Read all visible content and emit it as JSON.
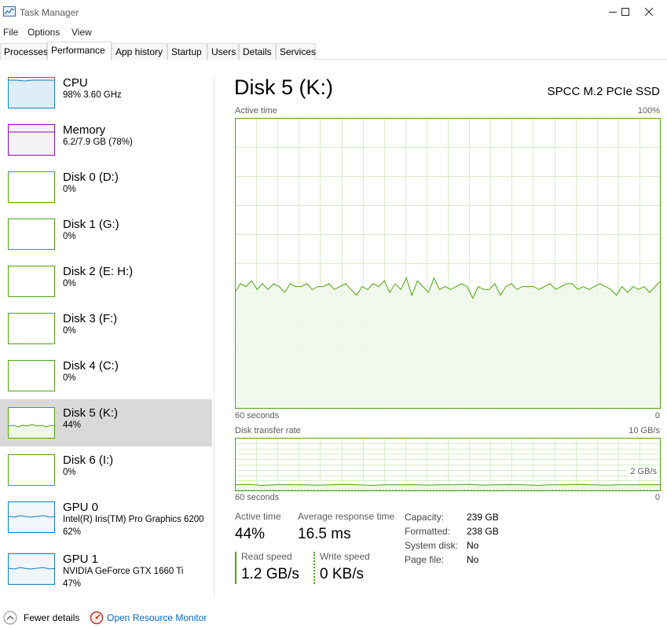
{
  "window": {
    "title": "Task Manager"
  },
  "menu": [
    "File",
    "Options",
    "View"
  ],
  "tabs": [
    "Processes",
    "Performance",
    "App history",
    "Startup",
    "Users",
    "Details",
    "Services"
  ],
  "active_tab": "Performance",
  "sidebar": {
    "items": [
      {
        "name": "CPU",
        "sub": "98% 3.60 GHz",
        "color": "#117dbb",
        "fill": "#f1f6fa"
      },
      {
        "name": "Memory",
        "sub": "6.2/7.9 GB (78%)",
        "color": "#8b12ae",
        "fill": "#f4f2f4"
      },
      {
        "name": "Disk 0 (D:)",
        "sub": "0%",
        "color": "#4da60c",
        "fill": "#ffffff"
      },
      {
        "name": "Disk 1 (G:)",
        "sub": "0%",
        "color": "#4da60c",
        "fill": "#ffffff"
      },
      {
        "name": "Disk 2 (E: H:)",
        "sub": "0%",
        "color": "#4da60c",
        "fill": "#ffffff"
      },
      {
        "name": "Disk 3 (F:)",
        "sub": "0%",
        "color": "#4da60c",
        "fill": "#ffffff"
      },
      {
        "name": "Disk 4 (C:)",
        "sub": "0%",
        "color": "#4da60c",
        "fill": "#ffffff"
      },
      {
        "name": "Disk 5 (K:)",
        "sub": "44%",
        "color": "#4da60c",
        "fill": "#ffffff"
      },
      {
        "name": "Disk 6 (I:)",
        "sub": "0%",
        "color": "#4da60c",
        "fill": "#ffffff"
      },
      {
        "name": "GPU 0",
        "sub": "Intel(R) Iris(TM) Pro Graphics 6200",
        "sub2": "62%",
        "color": "#117dbb",
        "fill": "#f1f6fa"
      },
      {
        "name": "GPU 1",
        "sub": "NVIDIA GeForce GTX 1660 Ti",
        "sub2": "47%",
        "color": "#117dbb",
        "fill": "#f1f6fa"
      }
    ],
    "selected_index": 7
  },
  "main": {
    "title": "Disk 5 (K:)",
    "model": "SPCC M.2 PCIe SSD",
    "graph1": {
      "label": "Active time",
      "max_label": "100%",
      "time_label": "60 seconds",
      "min_label": "0"
    },
    "graph2": {
      "label": "Disk transfer rate",
      "max_label": "10 GB/s",
      "mid_label": "2 GB/s",
      "time_label": "60 seconds",
      "min_label": "0"
    },
    "stats": {
      "active_time_label": "Active time",
      "active_time_value": "44%",
      "response_label": "Average response time",
      "response_value": "16.5 ms",
      "read_label": "Read speed",
      "read_value": "1.2 GB/s",
      "write_label": "Write speed",
      "write_value": "0 KB/s"
    },
    "details": [
      {
        "key": "Capacity:",
        "value": "239 GB"
      },
      {
        "key": "Formatted:",
        "value": "238 GB"
      },
      {
        "key": "System disk:",
        "value": "No"
      },
      {
        "key": "Page file:",
        "value": "No"
      }
    ]
  },
  "footer": {
    "fewer_details": "Fewer details",
    "resource_monitor": "Open Resource Monitor"
  },
  "colors": {
    "disk_line": "#4da60c",
    "disk_fill": "#eff7ea",
    "grid": "#d7ecc9",
    "link": "#0066cc"
  },
  "chart_data": [
    {
      "type": "area",
      "title": "Active time",
      "ylim": [
        0,
        100
      ],
      "unit": "%",
      "x_span_seconds": 60,
      "values": [
        40,
        43,
        42,
        44,
        41,
        43,
        41,
        43,
        42,
        40,
        43,
        42,
        42,
        43,
        41,
        42,
        42,
        43,
        41,
        42,
        43,
        41,
        39,
        42,
        41,
        43,
        42,
        44,
        40,
        43,
        41,
        45,
        39,
        44,
        42,
        40,
        45,
        41,
        42,
        41,
        42,
        43,
        42,
        38,
        42,
        41,
        41,
        43,
        39,
        42,
        43,
        41,
        42,
        42,
        42,
        41,
        42,
        43,
        41,
        42,
        43,
        43,
        41,
        42,
        41,
        42,
        43,
        42,
        41,
        39,
        42,
        40,
        42,
        41,
        42,
        40,
        42,
        44
      ]
    },
    {
      "type": "line",
      "title": "Disk transfer rate",
      "ylim": [
        0,
        10
      ],
      "unit": "GB/s",
      "x_span_seconds": 60,
      "series": [
        {
          "name": "Read speed",
          "values": [
            1.2,
            1.3,
            1.1,
            1.2,
            1.25,
            1.2,
            1.15,
            1.2,
            1.3,
            1.2,
            1.1,
            1.2,
            1.2,
            1.25,
            1.15,
            1.2,
            1.2,
            1.3,
            1.15,
            1.2,
            1.25,
            1.2,
            1.1,
            1.2,
            1.2,
            1.3,
            1.2,
            1.15,
            1.2,
            1.2,
            1.25,
            1.2
          ]
        },
        {
          "name": "Write speed",
          "values": [
            0,
            0,
            0,
            0,
            0,
            0,
            0,
            0,
            0,
            0,
            0,
            0,
            0,
            0,
            0,
            0,
            0,
            0,
            0,
            0,
            0,
            0,
            0,
            0,
            0,
            0,
            0,
            0,
            0,
            0,
            0,
            0
          ]
        }
      ]
    }
  ]
}
